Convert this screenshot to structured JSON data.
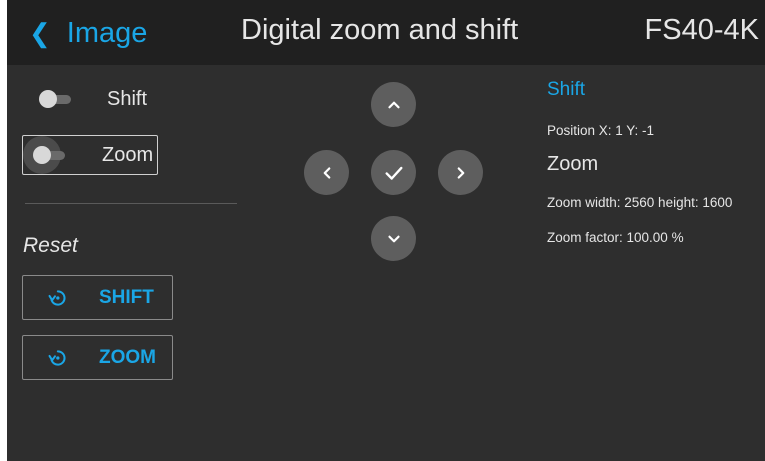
{
  "header": {
    "back_label": "Image",
    "title": "Digital zoom and shift",
    "device": "FS40-4K"
  },
  "toggles": {
    "shift_label": "Shift",
    "zoom_label": "Zoom"
  },
  "reset": {
    "heading": "Reset",
    "shift_label": "SHIFT",
    "zoom_label": "ZOOM"
  },
  "info": {
    "shift_title": "Shift",
    "position_text": "Position X: 1 Y: -1",
    "zoom_title": "Zoom",
    "zoom_size_text": "Zoom width: 2560 height: 1600",
    "zoom_factor_text": "Zoom factor: 100.00 %"
  },
  "icons": {
    "back": "chevron-left-icon",
    "up": "chevron-up-icon",
    "down": "chevron-down-icon",
    "left": "chevron-left-icon",
    "right": "chevron-right-icon",
    "ok": "checkmark-icon",
    "reset": "reset-icon"
  },
  "colors": {
    "accent": "#1aa6e6",
    "background": "#2e2e2e",
    "header_background": "#202020",
    "text": "#e6e6e6",
    "dpad_button": "#5e5e5e"
  }
}
